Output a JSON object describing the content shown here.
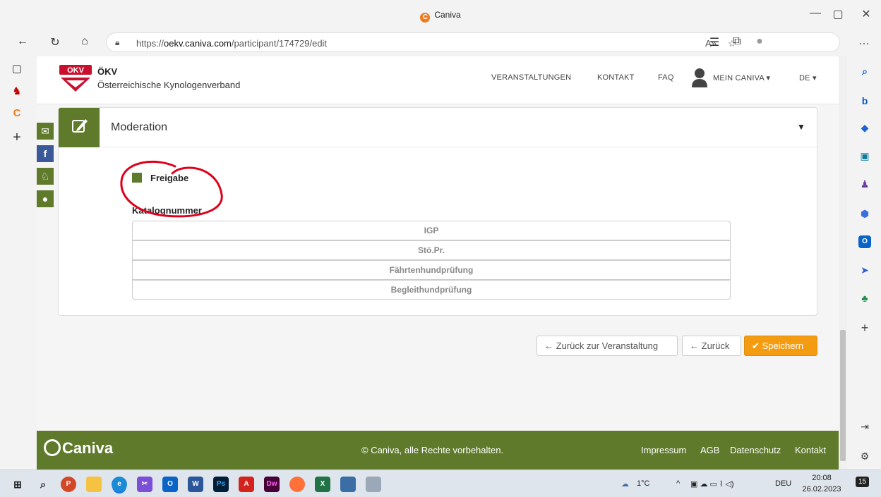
{
  "window": {
    "title": "Caniva",
    "minimize": "—",
    "restore": "▢",
    "close": "✕"
  },
  "addressbar": {
    "url_prefix": "https://",
    "url_host": "oekv.caniva.com",
    "url_path": "/participant/174729/edit"
  },
  "site": {
    "brand_name": "ÖKV",
    "brand_subtitle": "Österreichische Kynologenverband",
    "nav": {
      "veranstaltungen": "VERANSTALTUNGEN",
      "kontakt": "KONTAKT",
      "faq": "FAQ",
      "mein_caniva": "MEIN CANIVA",
      "lang": "DE"
    }
  },
  "card": {
    "title": "Moderation",
    "checkbox_label": "Freigabe",
    "katalog_label": "Katalognummer",
    "list_items": [
      "IGP",
      "Stö.Pr.",
      "Fährtenhundprüfung",
      "Begleithundprüfung"
    ]
  },
  "actions": {
    "back_to_event": "Zurück zur Veranstaltung",
    "back": "Zurück",
    "save": "Speichern"
  },
  "footer": {
    "logo": "Caniva",
    "copyright": "© Caniva, alle Rechte vorbehalten.",
    "links": [
      "Impressum",
      "AGB",
      "Datenschutz",
      "Kontakt"
    ]
  },
  "taskbar": {
    "weather": "1°C",
    "lang": "DEU",
    "time": "20:08",
    "date": "26.02.2023",
    "notifications": "15"
  },
  "colors": {
    "brand_green": "#5e7a2a",
    "save_orange": "#f39c12",
    "annotation_red": "#e0001b"
  }
}
